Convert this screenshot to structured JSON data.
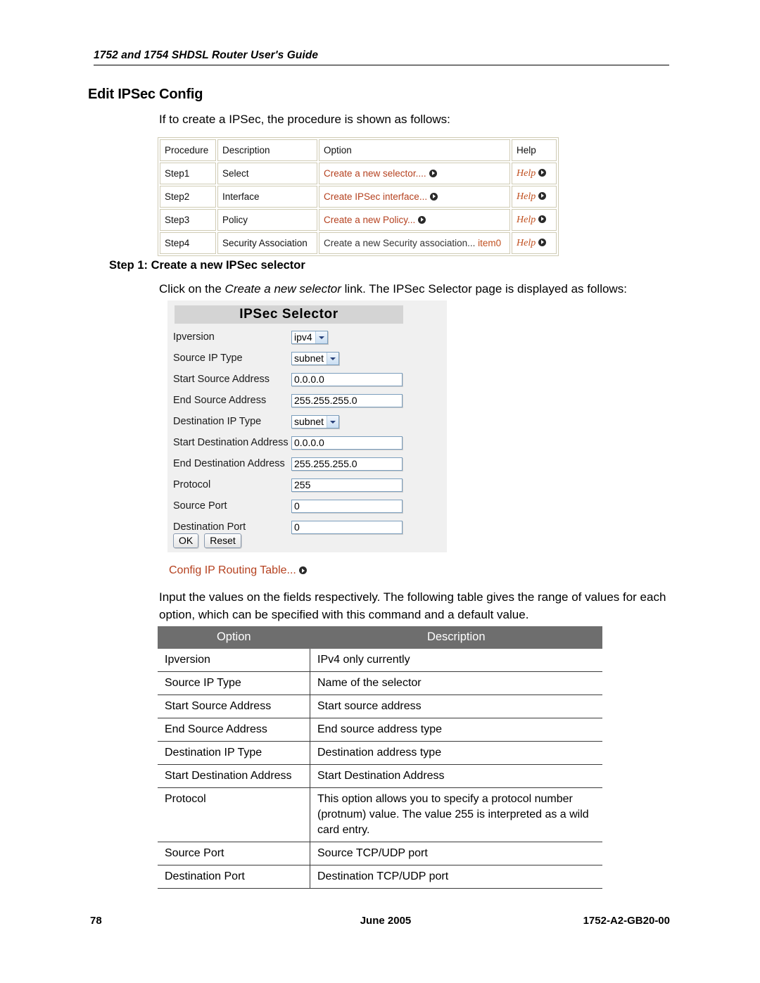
{
  "header": {
    "running_head": "1752 and 1754 SHDSL Router User's Guide"
  },
  "section": {
    "title": "Edit IPSec Config",
    "intro_paragraph": "If to create a IPSec, the procedure is shown as follows:"
  },
  "procedure_table": {
    "columns": [
      "Procedure",
      "Description",
      "Option",
      "Help"
    ],
    "rows": [
      {
        "procedure": "Step1",
        "description": "Select",
        "option": "Create a new selector....",
        "option_style": "link",
        "option_suffix": "",
        "help": "Help"
      },
      {
        "procedure": "Step2",
        "description": "Interface",
        "option": "Create IPSec interface...",
        "option_style": "link",
        "option_suffix": "",
        "help": "Help"
      },
      {
        "procedure": "Step3",
        "description": "Policy",
        "option": "Create a new Policy...",
        "option_style": "link",
        "option_suffix": "",
        "help": "Help"
      },
      {
        "procedure": "Step4",
        "description": "Security Association",
        "option": "Create a new Security association...",
        "option_style": "plain",
        "option_suffix": "item0",
        "help": "Help"
      }
    ]
  },
  "step1": {
    "heading": "Step 1: Create a new IPSec selector",
    "paragraph_before": "Click on the ",
    "paragraph_italic": "Create a new selector",
    "paragraph_after": " link. The IPSec Selector page is displayed as follows:"
  },
  "selector_form": {
    "title": "IPSec Selector",
    "fields": [
      {
        "label": "Ipversion",
        "type": "select",
        "value": "ipv4"
      },
      {
        "label": "Source IP Type",
        "type": "select",
        "value": "subnet"
      },
      {
        "label": "Start Source Address",
        "type": "input",
        "value": "0.0.0.0"
      },
      {
        "label": "End Source Address",
        "type": "input",
        "value": "255.255.255.0"
      },
      {
        "label": "Destination IP Type",
        "type": "select",
        "value": "subnet"
      },
      {
        "label": "Start Destination Address",
        "type": "input",
        "value": "0.0.0.0"
      },
      {
        "label": "End Destination Address",
        "type": "input",
        "value": "255.255.255.0"
      },
      {
        "label": "Protocol",
        "type": "input",
        "value": "255"
      },
      {
        "label": "Source Port",
        "type": "input",
        "value": "0"
      },
      {
        "label": "Destination Port",
        "type": "input",
        "value": "0"
      }
    ],
    "ok_label": "OK",
    "reset_label": "Reset",
    "routing_link": "Config IP Routing Table..."
  },
  "input_paragraph": "Input the values on the fields respectively. The following table gives the range of values for each option, which can be specified with this command and a default value.",
  "options_table": {
    "columns": [
      "Option",
      "Description"
    ],
    "rows": [
      {
        "option": "Ipversion",
        "description": "IPv4 only currently"
      },
      {
        "option": "Source IP Type",
        "description": "Name of the selector"
      },
      {
        "option": "Start Source Address",
        "description": "Start source address"
      },
      {
        "option": "End Source Address",
        "description": "End source address type"
      },
      {
        "option": "Destination IP Type",
        "description": "Destination address type"
      },
      {
        "option": "Start Destination Address",
        "description": "Start Destination Address"
      },
      {
        "option": "Protocol",
        "description": "This option allows you to specify a protocol number (protnum) value. The value 255 is interpreted as a wild card entry."
      },
      {
        "option": "Source Port",
        "description": "Source TCP/UDP port"
      },
      {
        "option": "Destination Port",
        "description": "Destination TCP/UDP port"
      }
    ]
  },
  "footer": {
    "page_number": "78",
    "date": "June 2005",
    "doc_number": "1752-A2-GB20-00"
  },
  "colors": {
    "link_red": "#b5411f",
    "item_orange": "#c0501f",
    "table_header_gray": "#6e6e6e",
    "panel_bg": "#f0f0f0",
    "titlebar_gray": "#d4d4d4"
  }
}
